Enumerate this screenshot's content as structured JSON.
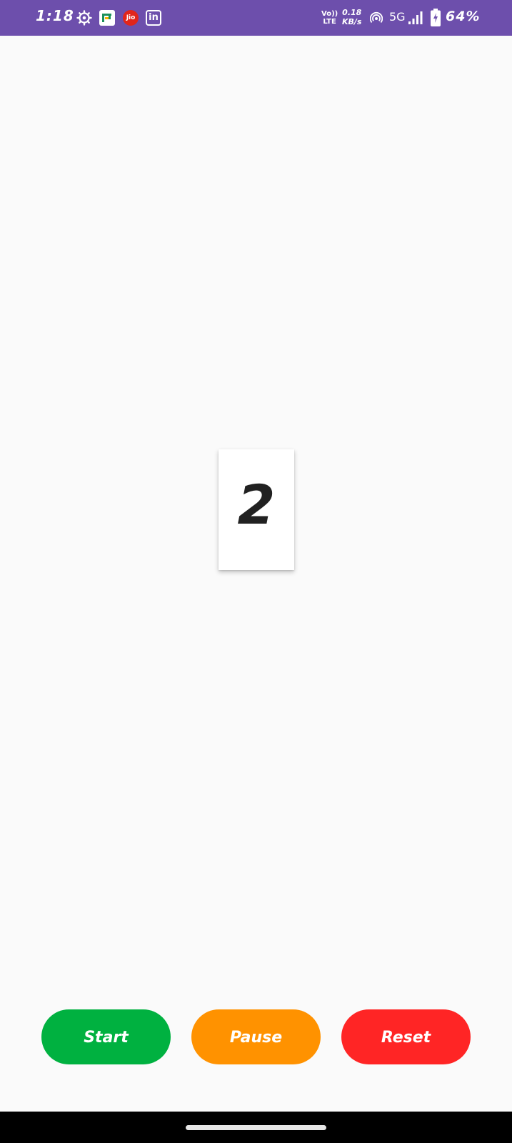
{
  "status_bar": {
    "time": "1:18",
    "jio_label": "Jio",
    "linkedin_label": "in",
    "volte_top": "Vo))",
    "volte_bottom": "LTE",
    "net_speed_value": "0.18",
    "net_speed_unit": "KB/s",
    "network_type": "5G",
    "battery": "64%",
    "icons": [
      "settings-gear-icon",
      "app-notification-icon",
      "jio-icon",
      "linkedin-icon",
      "volte-icon",
      "hotspot-icon",
      "signal-icon",
      "battery-charging-icon"
    ]
  },
  "counter": {
    "value": "2"
  },
  "buttons": {
    "start": "Start",
    "pause": "Pause",
    "reset": "Reset"
  },
  "colors": {
    "status_bar": "#6d4fac",
    "start": "#00b140",
    "pause": "#ff9200",
    "reset": "#ff2525",
    "background": "#fafafa"
  }
}
